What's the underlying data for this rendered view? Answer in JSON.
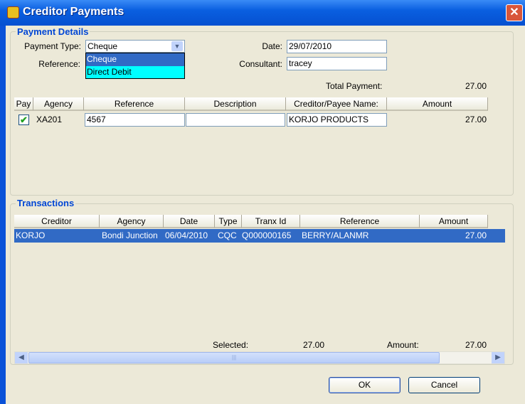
{
  "window": {
    "title": "Creditor Payments",
    "close_icon": "close-icon"
  },
  "payment_details": {
    "group_label": "Payment Details",
    "payment_type_label": "Payment Type:",
    "payment_type_value": "Cheque",
    "payment_type_options": [
      "Cheque",
      "Direct Debit"
    ],
    "reference_label": "Reference:",
    "date_label": "Date:",
    "date_value": "29/07/2010",
    "consultant_label": "Consultant:",
    "consultant_value": "tracey",
    "total_payment_label": "Total Payment:",
    "total_payment_value": "27.00",
    "columns": [
      "Pay",
      "Agency",
      "Reference",
      "Description",
      "Creditor/Payee Name:",
      "Amount"
    ],
    "rows": [
      {
        "pay": true,
        "agency": "XA201",
        "reference": "4567",
        "description": "",
        "creditor": "KORJO PRODUCTS",
        "amount": "27.00"
      }
    ]
  },
  "transactions": {
    "group_label": "Transactions",
    "columns": [
      "Creditor",
      "Agency",
      "Date",
      "Type",
      "Tranx Id",
      "Reference",
      "Amount"
    ],
    "rows": [
      [
        "KORJO",
        "Bondi Junction",
        "06/04/2010",
        "CQC",
        "Q000000165",
        "BERRY/ALANMR",
        "27.00"
      ]
    ],
    "selected_label": "Selected:",
    "selected_value": "27.00",
    "amount_label": "Amount:",
    "amount_value": "27.00"
  },
  "buttons": {
    "ok": "OK",
    "cancel": "Cancel"
  },
  "colors": {
    "selection": "#316ac5",
    "dropdown_highlight": "#00ffff",
    "group_label": "#0046d5"
  }
}
